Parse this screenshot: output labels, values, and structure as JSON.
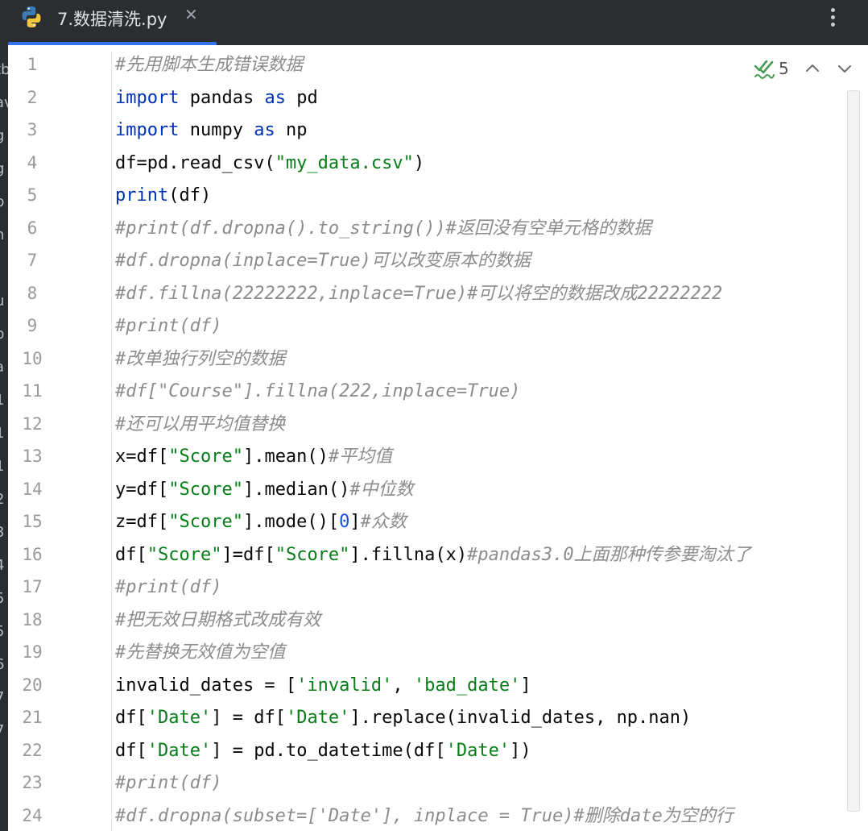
{
  "tab": {
    "title": "7.数据清洗.py",
    "close_glyph": "✕",
    "icon": "python-icon"
  },
  "toolbar": {
    "more_icon": "more-vertical-icon"
  },
  "inspections": {
    "count": "5",
    "icon": "double-check-icon"
  },
  "left_strip": [
    "tb",
    "av",
    "g",
    "g",
    "p",
    "n",
    "l",
    "u",
    "p",
    "a",
    "1",
    "1",
    "1",
    "2",
    "3",
    "4",
    "5",
    "5",
    "6",
    "7",
    "7"
  ],
  "lines": [
    {
      "n": "1",
      "parts": [
        [
          "cm",
          "#先用脚本生成错误数据"
        ]
      ]
    },
    {
      "n": "2",
      "parts": [
        [
          "kw",
          "import"
        ],
        [
          "",
          " pandas "
        ],
        [
          "kw",
          "as"
        ],
        [
          "",
          " pd"
        ]
      ]
    },
    {
      "n": "3",
      "parts": [
        [
          "kw",
          "import"
        ],
        [
          "",
          " numpy "
        ],
        [
          "kw",
          "as"
        ],
        [
          "",
          " np"
        ]
      ]
    },
    {
      "n": "4",
      "parts": [
        [
          "",
          "df=pd.read_csv("
        ],
        [
          "str",
          "\"my_data.csv\""
        ],
        [
          "",
          ")"
        ]
      ]
    },
    {
      "n": "5",
      "parts": [
        [
          "kw",
          "print"
        ],
        [
          "",
          "(df)"
        ]
      ]
    },
    {
      "n": "6",
      "parts": [
        [
          "cm",
          "#print(df.dropna().to_string())#返回没有空单元格的数据"
        ]
      ]
    },
    {
      "n": "7",
      "parts": [
        [
          "cm",
          "#df.dropna(inplace=True)可以改变原本的数据"
        ]
      ]
    },
    {
      "n": "8",
      "parts": [
        [
          "cm",
          "#df.fillna(22222222,inplace=True)#可以将空的数据改成22222222"
        ]
      ]
    },
    {
      "n": "9",
      "parts": [
        [
          "cm",
          "#print(df)"
        ]
      ]
    },
    {
      "n": "10",
      "parts": [
        [
          "cm",
          "#改单独行列空的数据"
        ]
      ]
    },
    {
      "n": "11",
      "parts": [
        [
          "cm",
          "#df[\"Course\"].fillna(222,inplace=True)"
        ]
      ]
    },
    {
      "n": "12",
      "parts": [
        [
          "cm",
          "#还可以用平均值替换"
        ]
      ]
    },
    {
      "n": "13",
      "parts": [
        [
          "",
          "x=df["
        ],
        [
          "str",
          "\"Score\""
        ],
        [
          "",
          "].mean()"
        ],
        [
          "cm",
          "#平均值"
        ]
      ]
    },
    {
      "n": "14",
      "parts": [
        [
          "",
          "y=df["
        ],
        [
          "str",
          "\"Score\""
        ],
        [
          "",
          "].median()"
        ],
        [
          "cm",
          "#中位数"
        ]
      ]
    },
    {
      "n": "15",
      "parts": [
        [
          "",
          "z=df["
        ],
        [
          "str",
          "\"Score\""
        ],
        [
          "",
          "].mode()["
        ],
        [
          "num",
          "0"
        ],
        [
          "",
          "]"
        ],
        [
          "cm",
          "#众数"
        ]
      ]
    },
    {
      "n": "16",
      "parts": [
        [
          "",
          "df["
        ],
        [
          "str",
          "\"Score\""
        ],
        [
          "",
          "]=df["
        ],
        [
          "str",
          "\"Score\""
        ],
        [
          "",
          "].fillna(x)"
        ],
        [
          "cm",
          "#pandas3.0上面那种传参要淘汰了"
        ]
      ]
    },
    {
      "n": "17",
      "parts": [
        [
          "cm",
          "#print(df)"
        ]
      ]
    },
    {
      "n": "18",
      "parts": [
        [
          "cm",
          "#把无效日期格式改成有效"
        ]
      ]
    },
    {
      "n": "19",
      "parts": [
        [
          "cm",
          "#先替换无效值为空值"
        ]
      ]
    },
    {
      "n": "20",
      "parts": [
        [
          "",
          "invalid_dates = ["
        ],
        [
          "str",
          "'invalid'"
        ],
        [
          "",
          ", "
        ],
        [
          "str",
          "'bad_date'"
        ],
        [
          "",
          "]"
        ]
      ]
    },
    {
      "n": "21",
      "parts": [
        [
          "",
          "df["
        ],
        [
          "str",
          "'Date'"
        ],
        [
          "",
          "] = df["
        ],
        [
          "str",
          "'Date'"
        ],
        [
          "",
          "].replace(invalid_dates, np.nan)"
        ]
      ]
    },
    {
      "n": "22",
      "parts": [
        [
          "",
          "df["
        ],
        [
          "str",
          "'Date'"
        ],
        [
          "",
          "] = pd.to_datetime(df["
        ],
        [
          "str",
          "'Date'"
        ],
        [
          "",
          "])"
        ]
      ]
    },
    {
      "n": "23",
      "parts": [
        [
          "cm",
          "#print(df)"
        ]
      ]
    },
    {
      "n": "24",
      "parts": [
        [
          "cm",
          "#df.dropna(subset=['Date'], inplace = True)#删除date为空的行"
        ]
      ]
    }
  ]
}
